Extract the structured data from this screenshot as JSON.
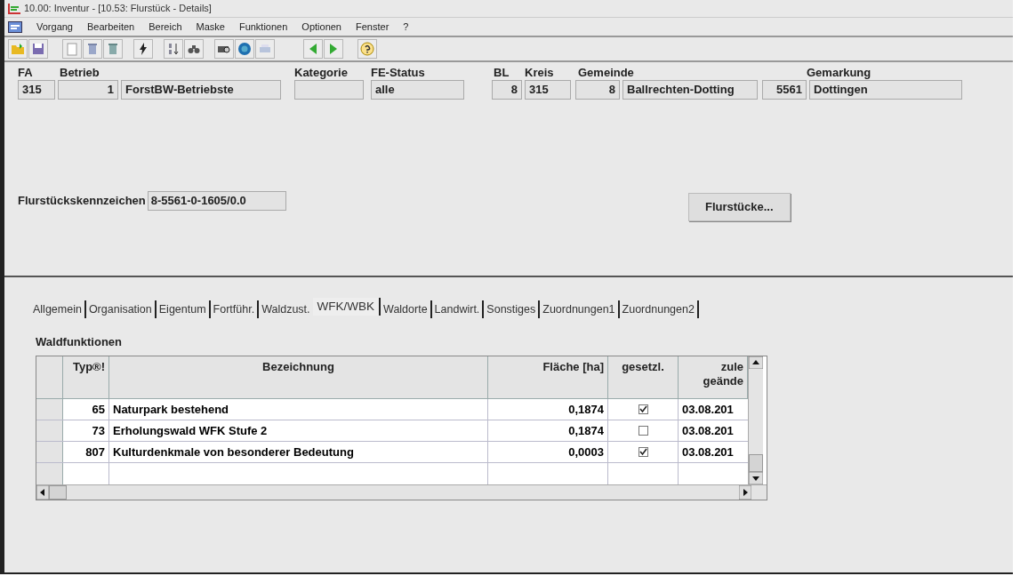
{
  "window": {
    "title": "10.00: Inventur - [10.53: Flurstück - Details]"
  },
  "menu": [
    {
      "label": "Vorgang"
    },
    {
      "label": "Bearbeiten"
    },
    {
      "label": "Bereich"
    },
    {
      "label": "Maske"
    },
    {
      "label": "Funktionen"
    },
    {
      "label": "Optionen"
    },
    {
      "label": "Fenster"
    },
    {
      "label": "?"
    }
  ],
  "header": [
    {
      "label": "FA",
      "fields": [
        "315"
      ]
    },
    {
      "label": "Betrieb",
      "fields": [
        "1",
        "ForstBW-Betriebste"
      ]
    },
    {
      "label": "Kategorie",
      "empty_field": true
    },
    {
      "label": "FE-Status",
      "fields": [
        "alle"
      ]
    },
    {
      "label": "BL",
      "fields": [
        "8"
      ]
    },
    {
      "label": "Kreis",
      "fields": [
        "315"
      ]
    },
    {
      "label": "Gemeinde",
      "fields": [
        "8",
        "Ballrechten-Dotting"
      ]
    },
    {
      "label": "Gemarkung",
      "fields": [
        "5561",
        "Dottingen"
      ]
    }
  ],
  "flurstueckskennzeichen": {
    "label": "Flurstückskennzeichen",
    "value": "8-5561-0-1605/0.0"
  },
  "flurstuecke_button": "Flurstücke...",
  "tabs": [
    {
      "label": "Allgemein",
      "selected": false
    },
    {
      "label": "Organisation",
      "selected": false
    },
    {
      "label": "Eigentum",
      "selected": false
    },
    {
      "label": "Fortführ.",
      "selected": false
    },
    {
      "label": "Waldzust.",
      "selected": false
    },
    {
      "label": "WFK/WBK",
      "selected": true
    },
    {
      "label": "Waldorte",
      "selected": false
    },
    {
      "label": "Landwirt.",
      "selected": false
    },
    {
      "label": "Sonstiges",
      "selected": false
    },
    {
      "label": "Zuordnungen1",
      "selected": false
    },
    {
      "label": "Zuordnungen2",
      "selected": false
    }
  ],
  "section_title": "Waldfunktionen",
  "table": {
    "columns": [
      "Typ®!",
      "Bezeichnung",
      "Fläche [ha]",
      "gesetzl.",
      "zule\ngeände"
    ],
    "rows": [
      {
        "typ": "65",
        "bezeichnung": "Naturpark bestehend",
        "flaeche": "0,1874",
        "checked": true,
        "datum": "03.08.201"
      },
      {
        "typ": "73",
        "bezeichnung": "Erholungswald WFK Stufe 2",
        "flaeche": "0,1874",
        "checked": false,
        "datum": "03.08.201"
      },
      {
        "typ": "807",
        "bezeichnung": "Kulturdenkmale von besonderer Bedeutung",
        "flaeche": "0,0003",
        "checked": true,
        "datum": "03.08.201"
      }
    ]
  }
}
